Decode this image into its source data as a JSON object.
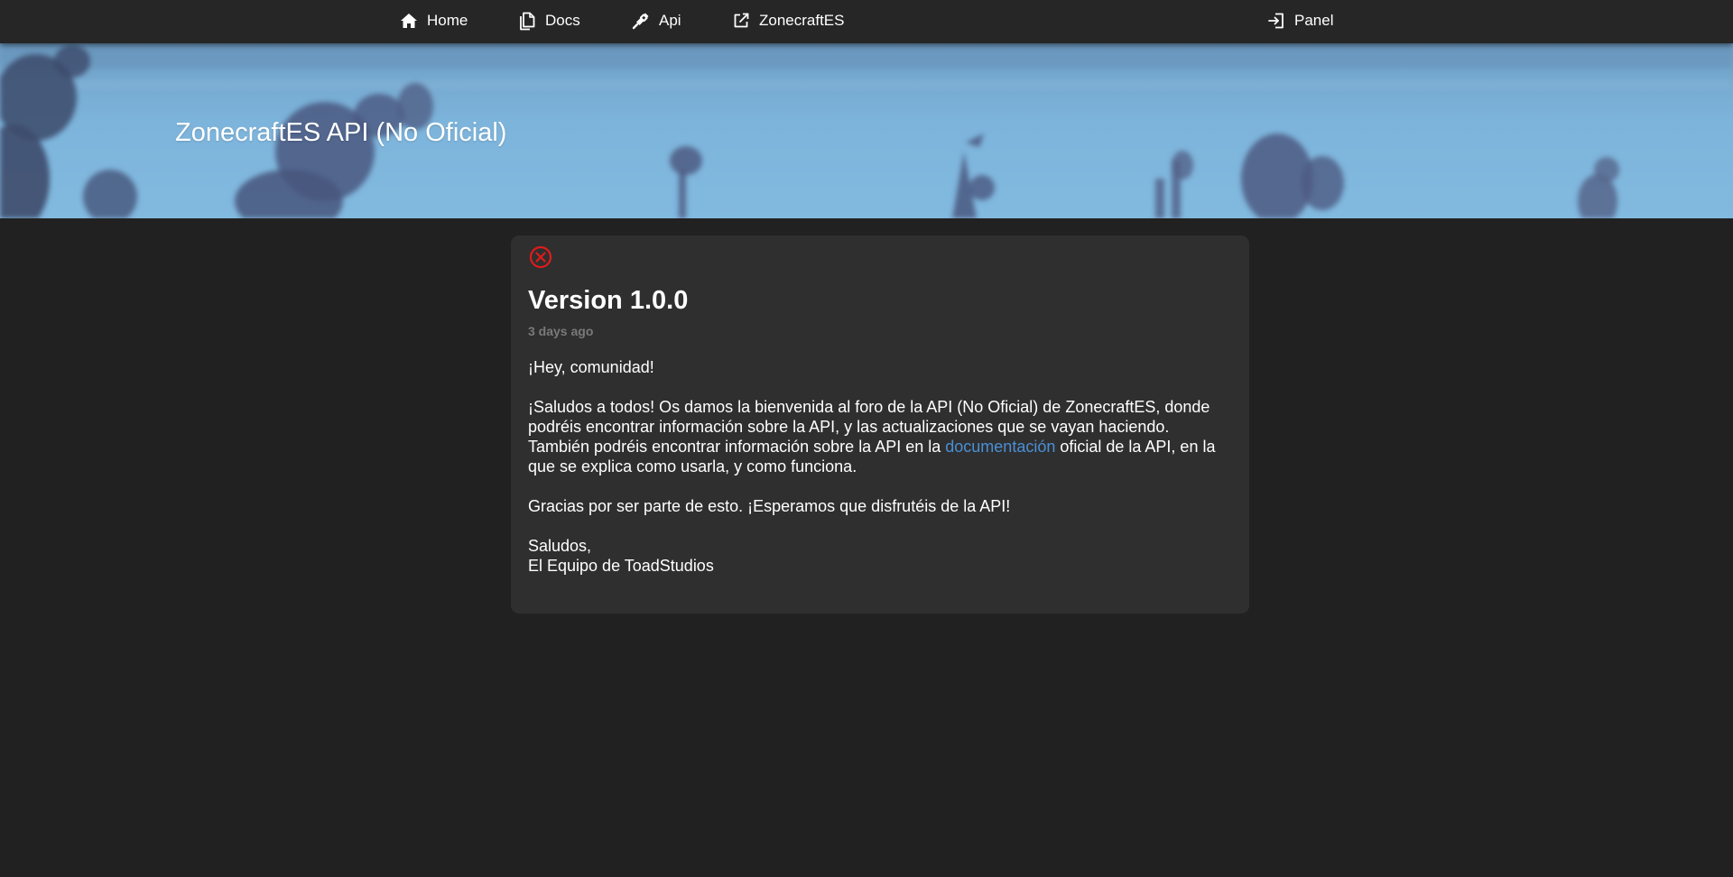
{
  "nav": {
    "home": {
      "label": "Home",
      "icon": "home-icon"
    },
    "docs": {
      "label": "Docs",
      "icon": "docs-icon"
    },
    "api": {
      "label": "Api",
      "icon": "plug-icon"
    },
    "zonecraft": {
      "label": "ZonecraftES",
      "icon": "external-link-icon"
    },
    "panel": {
      "label": "Panel",
      "icon": "login-icon"
    }
  },
  "hero": {
    "title": "ZonecraftES API (No Oficial)"
  },
  "post": {
    "status_icon": "error-circle-x-icon",
    "status_color": "#e01b1b",
    "title": "Version 1.0.0",
    "date": "3 days ago",
    "greeting": "¡Hey, comunidad!",
    "paragraph1": "¡Saludos a todos! Os damos la bienvenida al foro de la API (No Oficial) de ZonecraftES, donde podréis encontrar información sobre la API, y las actualizaciones que se vayan haciendo.",
    "paragraph2_before": "También podréis encontrar información sobre la API en la ",
    "paragraph2_link": "documentación",
    "paragraph2_after": " oficial de la API, en la que se explica como usarla, y como funciona.",
    "thanks": "Gracias por ser parte de esto. ¡Esperamos que disfrutéis de la API!",
    "signoff": "Saludos,",
    "signature": "El Equipo de ToadStudios"
  },
  "colors": {
    "background": "#212121",
    "topbar": "#262626",
    "card": "#2f2f2f",
    "link": "#4a8fd6",
    "muted": "#7a7a7a"
  }
}
